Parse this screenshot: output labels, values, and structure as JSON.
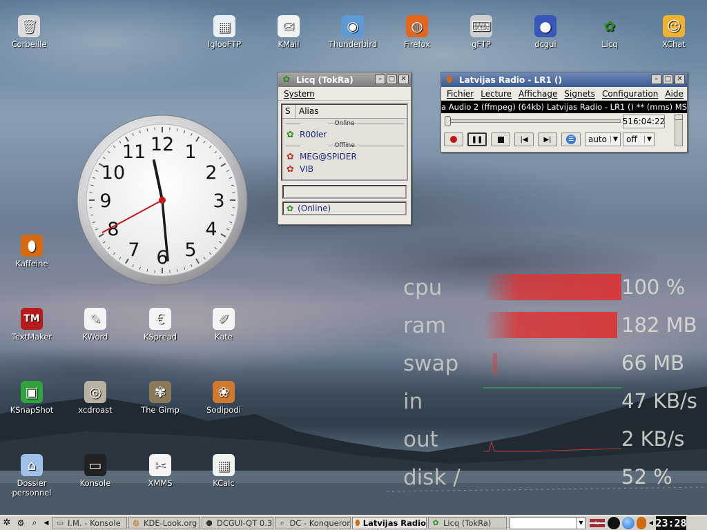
{
  "desktop": {
    "icons": [
      {
        "label": "Corbeille",
        "icon": "trash-icon"
      },
      {
        "label": "IglooFTP",
        "icon": "igloo-ftp-icon"
      },
      {
        "label": "KMail",
        "icon": "kmail-icon"
      },
      {
        "label": "Thunderbird",
        "icon": "thunderbird-icon"
      },
      {
        "label": "Firefox",
        "icon": "firefox-icon"
      },
      {
        "label": "gFTP",
        "icon": "gftp-icon"
      },
      {
        "label": "dcgui",
        "icon": "dcgui-icon"
      },
      {
        "label": "Licq",
        "icon": "licq-icon"
      },
      {
        "label": "XChat",
        "icon": "xchat-icon"
      },
      {
        "label": "Kaffeine",
        "icon": "kaffeine-icon"
      },
      {
        "label": "TextMaker",
        "icon": "textmaker-icon"
      },
      {
        "label": "KWord",
        "icon": "kword-icon"
      },
      {
        "label": "KSpread",
        "icon": "kspread-icon"
      },
      {
        "label": "Kate",
        "icon": "kate-icon"
      },
      {
        "label": "KSnapShot",
        "icon": "ksnapshot-icon"
      },
      {
        "label": "xcdroast",
        "icon": "xcdroast-icon"
      },
      {
        "label": "The Gimp",
        "icon": "gimp-icon"
      },
      {
        "label": "Sodipodi",
        "icon": "sodipodi-icon"
      },
      {
        "label": "Dossier\npersonnel",
        "icon": "home-folder-icon"
      },
      {
        "label": "Konsole",
        "icon": "konsole-icon"
      },
      {
        "label": "XMMS",
        "icon": "xmms-icon"
      },
      {
        "label": "KCalc",
        "icon": "kcalc-icon"
      }
    ]
  },
  "clock": {
    "numerals": [
      "12",
      "1",
      "2",
      "3",
      "4",
      "5",
      "6",
      "7",
      "8",
      "9",
      "10",
      "11"
    ],
    "time": "23:28"
  },
  "licq": {
    "title": "Licq (TokRa)",
    "menu": [
      "System"
    ],
    "columns": [
      "S",
      "Alias"
    ],
    "groups": [
      {
        "name": "Online",
        "contacts": [
          "R00ler"
        ]
      },
      {
        "name": "Offline",
        "contacts": [
          "MEG@SPIDER",
          "VIB"
        ]
      }
    ],
    "message_field": "",
    "status": "(Online)"
  },
  "radio": {
    "title": "Latvijas Radio - LR1 ()",
    "menu": [
      "Fichier",
      "Lecture",
      "Affichage",
      "Signets",
      "Configuration",
      "Aide"
    ],
    "info_left": "a Audio 2 (ffmpeg) (64kb)",
    "info_right": "Latvijas Radio - LR1 () ** (mms) MS",
    "time": "516:04:22",
    "aspect": "auto",
    "deinterlace": "off"
  },
  "monitor": {
    "rows": [
      {
        "label": "cpu",
        "value": "100 %",
        "fill": 1.0
      },
      {
        "label": "ram",
        "value": "182 MB",
        "fill": 0.97
      },
      {
        "label": "swap",
        "value": "66 MB",
        "fill": 0
      },
      {
        "label": "in",
        "value": "47 KB/s",
        "fill": 0
      },
      {
        "label": "out",
        "value": "2 KB/s",
        "fill": 0
      },
      {
        "label": "disk /",
        "value": "52 %",
        "fill": 0
      }
    ]
  },
  "taskbar": {
    "tasks": [
      {
        "label": "I.M. - Konsole",
        "icon": "konsole-icon",
        "active": false
      },
      {
        "label": "KDE-Look.org",
        "icon": "firefox-icon",
        "active": false
      },
      {
        "label": "DCGUI-QT 0.3",
        "icon": "dcgui-icon",
        "active": false
      },
      {
        "label": "DC - Konqueror",
        "icon": "konqueror-icon",
        "active": false
      },
      {
        "label": "Latvijas Radio",
        "icon": "kaffeine-icon",
        "active": true
      },
      {
        "label": "Licq (TokRa)",
        "icon": "licq-icon",
        "active": false
      }
    ],
    "tray_flag": "lv",
    "clock": "23:28"
  }
}
